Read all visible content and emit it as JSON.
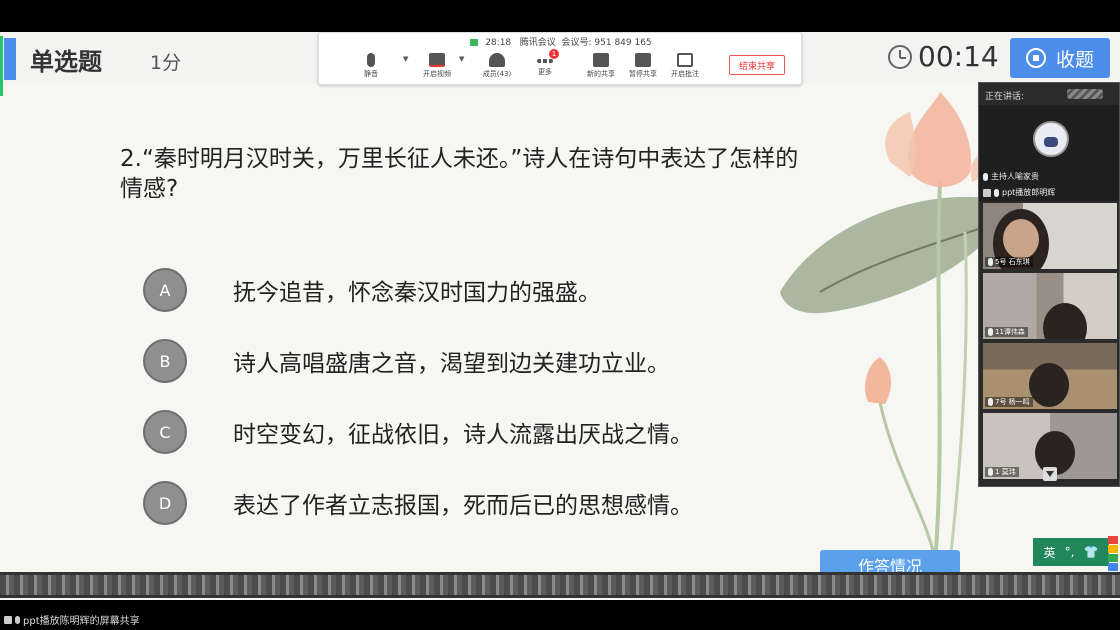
{
  "slide": {
    "question_type": "单选题",
    "score": "1分",
    "timer": "00:14",
    "collect_button": "收题",
    "question_line1": "2.“秦时明月汉时关，万里长征人未还。”诗人在诗句中表达了怎样的",
    "question_line2": "情感?",
    "options": [
      {
        "letter": "A",
        "text": "抚今追昔，怀念秦汉时国力的强盛。"
      },
      {
        "letter": "B",
        "text": "诗人高唱盛唐之音，渴望到边关建功立业。"
      },
      {
        "letter": "C",
        "text": "时空变幻，征战依旧，诗人流露出厌战之情。"
      },
      {
        "letter": "D",
        "text": "表达了作者立志报国，死而后已的思想感情。"
      }
    ],
    "answer_status_button": "作答情况",
    "ime": {
      "lang": "英",
      "punct": "°,",
      "skin": "👕"
    },
    "colors": {
      "accent": "#4b8de8",
      "option_circle": "#8f8f8f"
    }
  },
  "toolbar": {
    "time": "28:18",
    "app_name": "腾讯会议",
    "meeting_label": "会议号:",
    "meeting_id": "951 849 165",
    "buttons": {
      "mute": "静音",
      "video": "开启视频",
      "members": "成员(43)",
      "more": "更多",
      "new_share": "新的共享",
      "pause_share": "暂停共享",
      "annotate": "开启批注"
    },
    "more_badge": "1",
    "end_share": "结束共享"
  },
  "video_panel": {
    "speaking_label": "正在讲话:",
    "host_label": "主持人喻家贵",
    "screen_sharer": "ppt播放郎明辉",
    "participants": [
      {
        "name": "5号 石东琪"
      },
      {
        "name": "11谭伟森"
      },
      {
        "name": "7号 杨一鸣"
      },
      {
        "name": "1 莫玮"
      }
    ]
  },
  "bottom_bar": {
    "share_label": "ppt播放陈明辉的屏幕共享"
  }
}
